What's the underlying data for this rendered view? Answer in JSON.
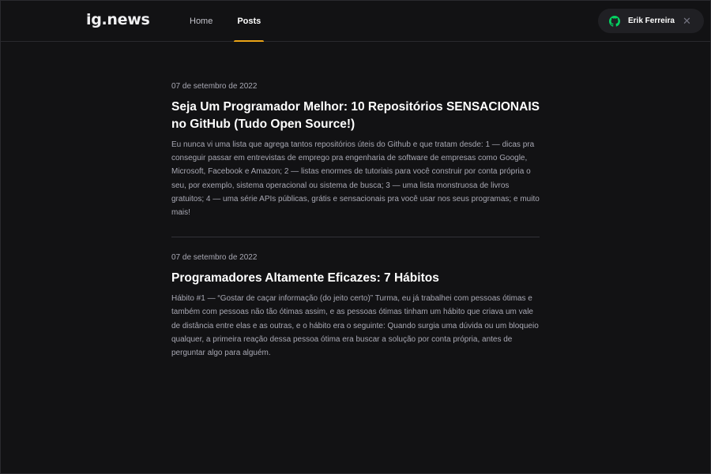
{
  "header": {
    "logo": "ig.news",
    "nav": [
      {
        "label": "Home",
        "active": false
      },
      {
        "label": "Posts",
        "active": true
      }
    ],
    "user": {
      "name": "Erik Ferreira",
      "icon": "github-icon",
      "icon_color": "#04d361"
    }
  },
  "posts": [
    {
      "date": "07 de setembro de 2022",
      "title": "Seja Um Programador Melhor: 10 Repositórios SENSACIONAIS no GitHub (Tudo Open Source!)",
      "excerpt": "Eu nunca vi uma lista que agrega tantos repositórios úteis do Github e que tratam desde: 1 — dicas pra conseguir passar em entrevistas de emprego pra engenharia de software de empresas como Google, Microsoft, Facebook e Amazon; 2 — listas enormes de tutoriais para você construir por conta própria o seu, por exemplo, sistema operacional ou sistema de busca; 3 — uma lista monstruosa de livros gratuitos; 4 — uma série APIs públicas, grátis e sensacionais pra você usar nos seus programas; e muito mais!"
    },
    {
      "date": "07 de setembro de 2022",
      "title": "Programadores Altamente Eficazes: 7 Hábitos",
      "excerpt": "Hábito #1 — “Gostar de caçar informação (do jeito certo)” Turma, eu já trabalhei com pessoas ótimas e também com pessoas não tão ótimas assim, e as pessoas ótimas tinham um hábito que criava um vale de distância entre elas e as outras, e o hábito era o seguinte: Quando surgia uma dúvida ou um bloqueio qualquer, a primeira reação dessa pessoa ótima era buscar a solução por conta própria, antes de perguntar algo para alguém."
    }
  ],
  "colors": {
    "background": "#121214",
    "accent": "#eba417",
    "github": "#04d361"
  }
}
